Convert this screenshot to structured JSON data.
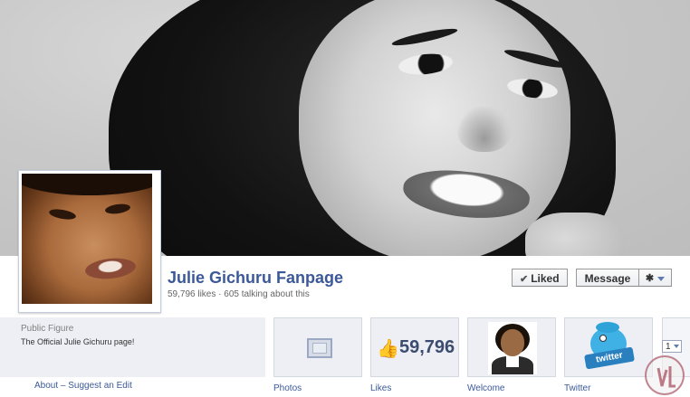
{
  "page": {
    "name": "Julie Gichuru Fanpage",
    "stats": "59,796 likes · 605 talking about this"
  },
  "actions": {
    "liked_label": "Liked",
    "message_label": "Message",
    "gear_icon": "gear-icon"
  },
  "info": {
    "category": "Public Figure",
    "description": "The Official Julie Gichuru page!",
    "links": "About – Suggest an Edit"
  },
  "apps": [
    {
      "label": "Photos",
      "icon": "photos-icon"
    },
    {
      "label": "Likes",
      "count": "59,796",
      "icon": "thumbs-up-icon"
    },
    {
      "label": "Welcome",
      "icon": "welcome-photo"
    },
    {
      "label": "Twitter",
      "icon": "twitter-bird-icon",
      "sign_text": "twitter"
    }
  ],
  "more": {
    "count": "1"
  },
  "colors": {
    "link": "#3b5998",
    "box_bg": "#edeff4",
    "border": "#d4d8e0"
  }
}
